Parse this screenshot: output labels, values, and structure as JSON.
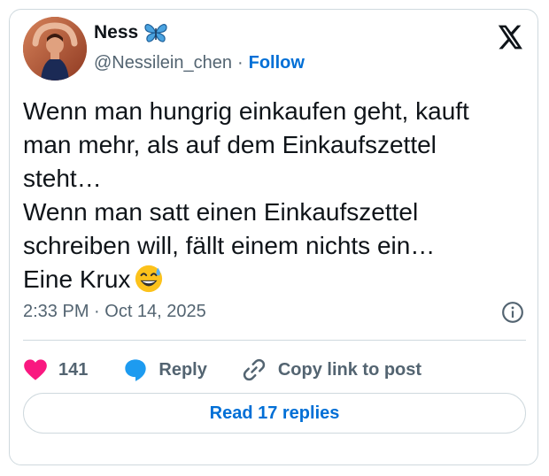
{
  "author": {
    "name": "Ness",
    "handle": "@Nessilein_chen",
    "separator": "·",
    "follow_label": "Follow",
    "name_emoji_icon": "butterfly-icon"
  },
  "tweet": {
    "text": "Wenn man hungrig einkaufen geht, kauft man mehr, als auf dem Einkaufszettel steht…\nWenn man satt einen Einkaufszettel schreiben will, fällt einem nichts ein…\nEine Krux",
    "trailing_emoji_icon": "grinning-sweat-emoji-icon",
    "time": "2:33 PM · Oct 14, 2025"
  },
  "actions": {
    "like_count": "141",
    "reply_label": "Reply",
    "copy_label": "Copy link to post"
  },
  "read_replies_label": "Read 17 replies",
  "colors": {
    "accent": "#006fd6",
    "like": "#f91880",
    "text": "#0f1419",
    "muted": "#536471",
    "border": "#cfd9de"
  }
}
